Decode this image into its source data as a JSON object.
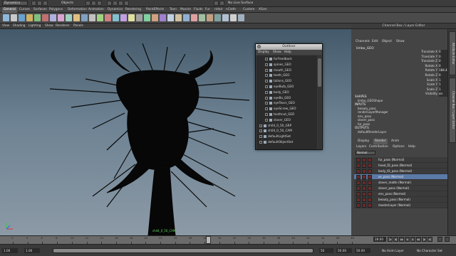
{
  "status_line": {
    "mode": "Dynamics",
    "selection_mode": "Objects",
    "live_surface": "No Live Surface"
  },
  "shelf": {
    "tabs": [
      "General",
      "Curves",
      "Surfaces",
      "Polygons",
      "Deformation",
      "Animation",
      "Dynamics",
      "Rendering",
      "PaintEffects",
      "Toon",
      "Muscle",
      "Fluids",
      "Fur",
      "nHair",
      "nCloth",
      "Custom",
      "XGen"
    ],
    "active_tab": "General"
  },
  "viewport": {
    "menu": [
      "View",
      "Shading",
      "Lighting",
      "Show",
      "Renderer",
      "Panels"
    ],
    "hud_camera": "shd4_0_50_CAM"
  },
  "outliner": {
    "title": "Outliner",
    "menu": [
      "Display",
      "Show",
      "Help"
    ],
    "items": [
      "furFeedback",
      "spines_GEO",
      "mouth_GEO",
      "teeth_GEO",
      "tailons_GEO",
      "eyeBulb_GEO",
      "body_GEO",
      "eyeBo_GEO",
      "eyeTears_GEO",
      "eyeScrew_GEO",
      "toothnut_GEO",
      "slaver_GEO",
      "sh04_0_50_GRP",
      "sh04_0_50_CAM",
      "defaultLightSet",
      "defaultObjectSet"
    ]
  },
  "channel_box": {
    "header": "Channel Box / Layer Editor",
    "menu": [
      "Channels",
      "Edit",
      "Object",
      "Show"
    ],
    "node": "limbo_GEO",
    "attributes": [
      {
        "name": "Translate X",
        "value": "0"
      },
      {
        "name": "Translate Y",
        "value": "0"
      },
      {
        "name": "Translate Z",
        "value": "0"
      },
      {
        "name": "Rotate X",
        "value": "0"
      },
      {
        "name": "Rotate Y",
        "value": "184.484"
      },
      {
        "name": "Rotate Z",
        "value": "0"
      },
      {
        "name": "Scale X",
        "value": "1"
      },
      {
        "name": "Scale Y",
        "value": "1"
      },
      {
        "name": "Scale Z",
        "value": "1"
      },
      {
        "name": "Visibility",
        "value": "on"
      }
    ],
    "shapes_title": "SHAPES",
    "shapes": [
      "limbo_GEOShape"
    ],
    "inputs_title": "INPUTS",
    "inputs": [
      "beauty_pass",
      "renderLayerManager",
      "env_pass",
      "slaver_pass",
      "fur_pass"
    ],
    "outputs_title": "OUTPUTS",
    "outputs": [
      "defaultRenderLayer"
    ]
  },
  "layer_editor": {
    "tabs": [
      "Display",
      "Render",
      "Anim"
    ],
    "active_tab": "Render",
    "menu": [
      "Layers",
      "Contribution",
      "Options",
      "Help"
    ],
    "mode": "Normal",
    "layers": [
      "fur_pass (Normal)",
      "head_ID_pass (Normal)",
      "body_ID_pass (Normal)",
      "se_pass (Normal)",
      "slaver_matte (Normal)",
      "slaver_pass (Normal)",
      "env_pass (Normal)",
      "beauty_pass (Normal)",
      "masterLayer (Normal)"
    ],
    "selected_index": 3
  },
  "vertical_tabs": [
    "Attribute Editor",
    "Channel Box / Layer Editor"
  ],
  "time_slider": {
    "ticks": [
      "2",
      "4",
      "6",
      "8",
      "10",
      "12",
      "14",
      "16",
      "18",
      "20",
      "22",
      "24",
      "26",
      "28",
      "30",
      "32",
      "34",
      "36",
      "38",
      "40",
      "42",
      "44",
      "46",
      "48"
    ],
    "current_frame": "28.00",
    "range": {
      "start": "1.00",
      "inner_start": "1.00",
      "inner_end": "50",
      "end": "50.00",
      "end2": "50.00"
    },
    "anim_layer": "No Anim Layer",
    "character_set": "No Character Set"
  },
  "colors": {
    "viewport_top": "#445a6a",
    "viewport_bottom": "#8c9aa6",
    "selected_layer": "#5b7aa8",
    "hud_text": "#5fd95f"
  }
}
